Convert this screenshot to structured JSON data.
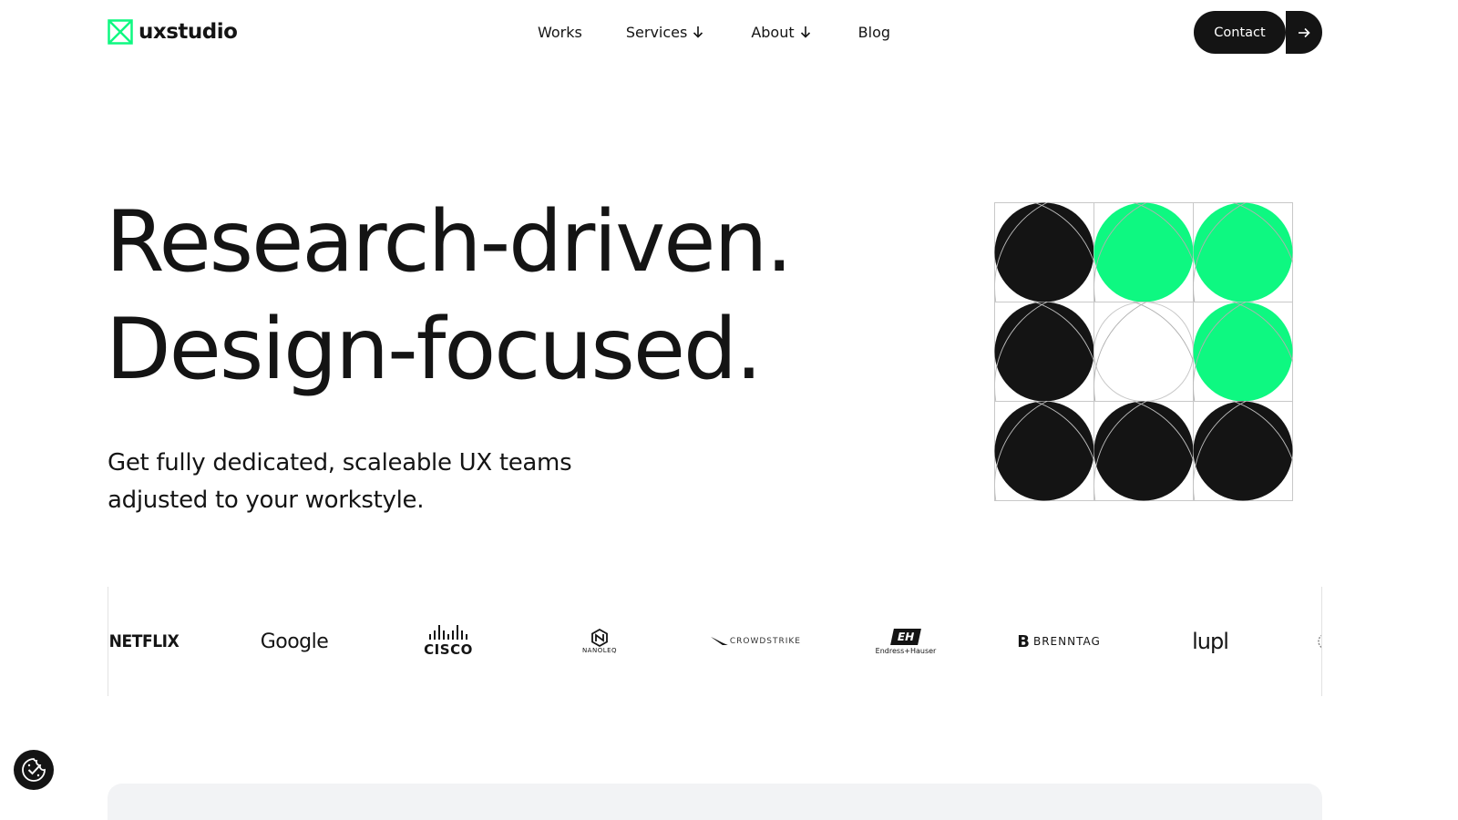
{
  "header": {
    "logo_text": "uxstudio",
    "nav": {
      "works": "Works",
      "services": "Services",
      "about": "About",
      "blog": "Blog"
    },
    "contact_label": "Contact"
  },
  "hero": {
    "title_line1": "Research-driven.",
    "title_line2": "Design-focused.",
    "subtitle": "Get fully dedicated, scaleable UX teams adjusted to your workstyle."
  },
  "clients": {
    "netflix": "NETFLIX",
    "google": "Google",
    "cisco": "CISCO",
    "nanoleq": "NANOLEQ",
    "crowdstrike": "CROWDSTRIKE",
    "endress_mark": "EH",
    "endress": "Endress+Hauser",
    "brenntag": "BRENNTAG",
    "brenntag_mark": "B",
    "lupl": "lupl"
  },
  "colors": {
    "accent_green": "#0ef881",
    "dark": "#141414",
    "grid_line": "#c8c8c8"
  },
  "art_cells": [
    "dark",
    "green",
    "green",
    "dark",
    "empty",
    "green",
    "dark",
    "dark",
    "dark"
  ],
  "icons": {
    "logo": "x-box-icon",
    "dropdown": "arrow-down-icon",
    "contact_arrow": "arrow-right-icon",
    "cookie": "cookie-check-icon"
  }
}
